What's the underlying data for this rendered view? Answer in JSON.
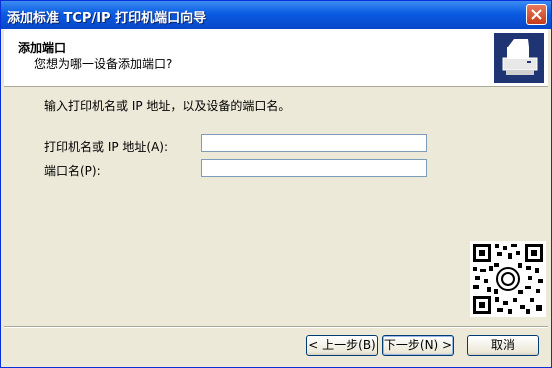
{
  "window": {
    "title": "添加标准 TCP/IP 打印机端口向导"
  },
  "header": {
    "title": "添加端口",
    "subtitle": "您想为哪一设备添加端口?"
  },
  "icons": {
    "close": "close-icon",
    "printer": "printer-icon",
    "qr": "qr-code"
  },
  "content": {
    "prompt": "输入打印机名或 IP 地址，以及设备的端口名。",
    "printer_label": "打印机名或 IP 地址(A):",
    "printer_value": "",
    "port_label": "端口名(P):",
    "port_value": ""
  },
  "buttons": {
    "back": "< 上一步(B)",
    "next": "下一步(N) >",
    "cancel": "取消"
  },
  "colors": {
    "titlebar": "#0a5be3",
    "header_bg": "#ffffff",
    "dialog_bg": "#ece9d8",
    "icon_bg": "#1f3573"
  }
}
